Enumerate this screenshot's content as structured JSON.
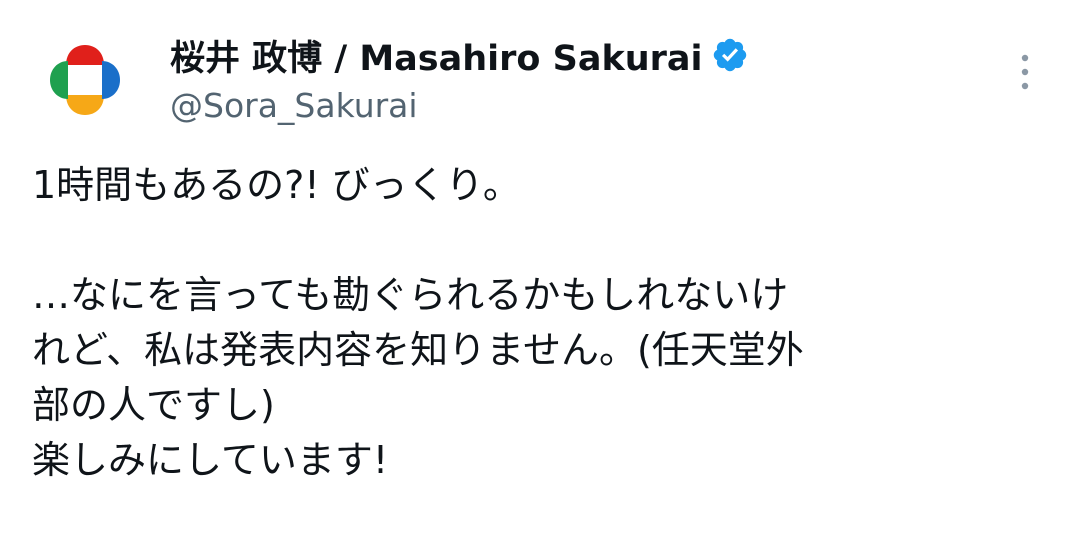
{
  "tweet": {
    "author": {
      "display_name": "桜井 政博 / Masahiro Sakurai",
      "handle": "@Sora_Sakurai",
      "verified": true,
      "avatar_icon": "plus-shaped-four-color-logo-icon"
    },
    "more_icon": "more-vertical-icon",
    "body_lines": [
      "1時間もあるの?! びっくり。",
      "",
      "…なにを言っても勘ぐられるかもしれないけ",
      "れど、私は発表内容を知りません。(任天堂外",
      "部の人ですし)",
      "楽しみにしています!"
    ]
  },
  "colors": {
    "name": "#0f1419",
    "handle": "#536471",
    "verified_badge": "#1d9bf0",
    "logo_red": "#e0201b",
    "logo_green": "#1fa04f",
    "logo_blue": "#1a6fc9",
    "logo_yellow": "#f6a817"
  }
}
